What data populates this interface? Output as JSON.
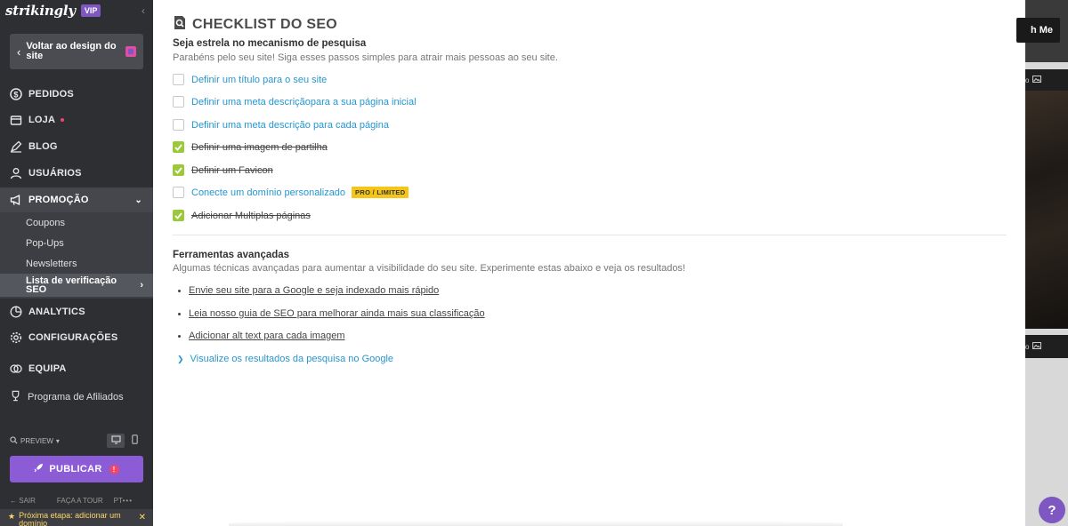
{
  "sidebar": {
    "logo": "strikingly",
    "vip_badge": "VIP",
    "back_label": "Voltar ao design do site",
    "nav": {
      "pedidos": "PEDIDOS",
      "loja": "LOJA",
      "blog": "BLOG",
      "usuarios": "USUÁRIOS",
      "promocao": "PROMOÇÃO",
      "analytics": "ANALYTICS",
      "configuracoes": "CONFIGURAÇÕES",
      "equipa": "EQUIPA"
    },
    "promocao_sub": {
      "coupons": "Coupons",
      "popups": "Pop-Ups",
      "newsletters": "Newsletters",
      "seo_checklist": "Lista de verificação SEO"
    },
    "affiliates": "Programa de Afiliados",
    "preview_label": "PREVIEW",
    "publish_label": "PUBLICAR",
    "bottom": {
      "sair": "SAIR",
      "tour": "FAÇA A TOUR",
      "lang": "PT",
      "more": "•••"
    },
    "next_step": "Próxima etapa: adicionar um domínio"
  },
  "panel": {
    "title": "CHECKLIST DO SEO",
    "section1": {
      "heading": "Seja estrela no mecanismo de pesquisa",
      "description": "Parabéns pelo seu site! Siga esses passos simples para atrair mais pessoas ao seu site."
    },
    "checklist": [
      {
        "label": "Definir um título para o seu site",
        "done": false
      },
      {
        "label": "Definir uma meta descriçãopara a sua página inicial",
        "done": false
      },
      {
        "label": "Definir uma meta descrição para cada página",
        "done": false
      },
      {
        "label": "Definir uma imagem de partilha",
        "done": true
      },
      {
        "label": "Definir um Favicon",
        "done": true
      },
      {
        "label": "Conecte um domínio personalizado",
        "done": false,
        "badge": "PRO / LIMITED"
      },
      {
        "label": "Adicionar Multiplas páginas",
        "done": true
      }
    ],
    "section2": {
      "heading": "Ferramentas avançadas",
      "description": "Algumas técnicas avançadas para aumentar a visibilidade do seu site. Experimente estas abaixo e veja os resultados!"
    },
    "tools": [
      "Envie seu site para a Google e seja indexado mais rápido",
      "Leia nosso guia de SEO para melhorar ainda mais sua classificação",
      "Adicionar alt text para cada imagem"
    ],
    "google_results": "Visualize os resultados da pesquisa no Google"
  },
  "preview_area": {
    "button_text": "h Me",
    "strip1": "o",
    "strip2": "o",
    "help": "?"
  },
  "colors": {
    "sidebar_bg": "#2e2f33",
    "accent_purple": "#8b5cd6",
    "link_blue": "#2596d0",
    "check_green": "#9cc93a",
    "badge_yellow": "#f5c518"
  }
}
